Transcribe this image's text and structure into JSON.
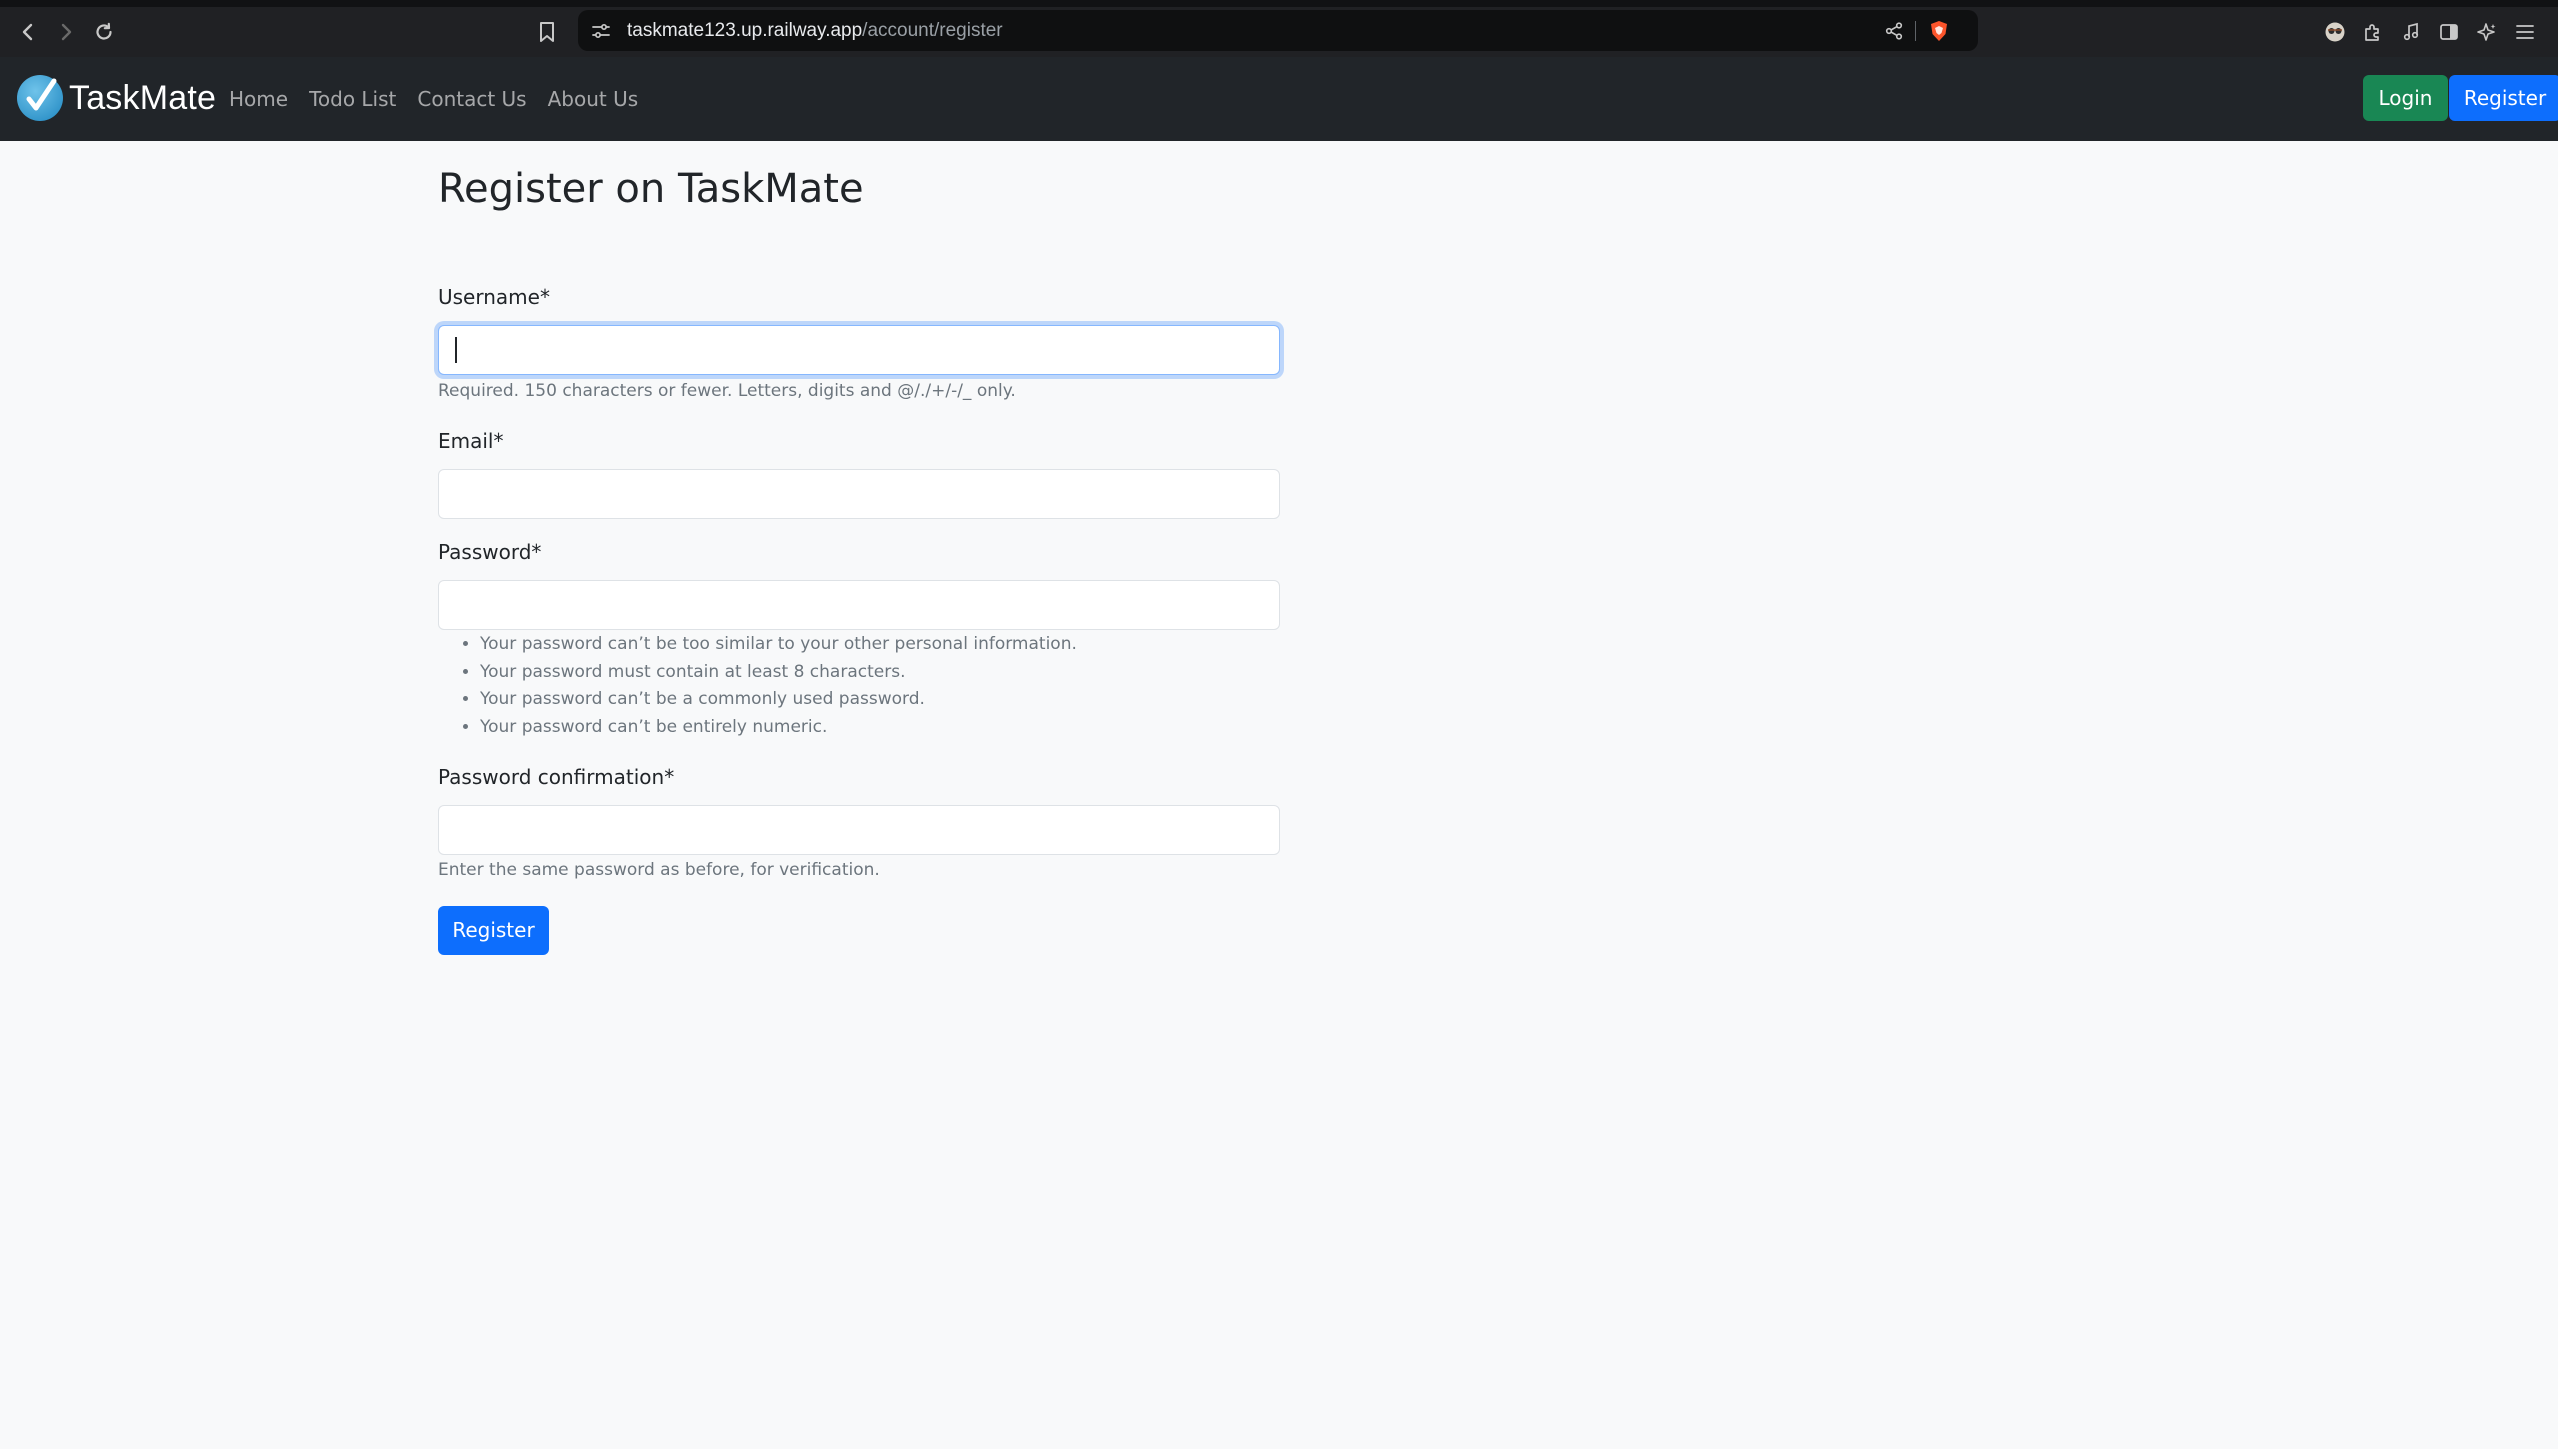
{
  "browser": {
    "url_host": "taskmate123.up.railway.app",
    "url_path": "/account/register",
    "icons": [
      "back-icon",
      "forward-icon",
      "reload-icon",
      "bookmark-icon",
      "site-settings-icon",
      "share-icon",
      "brave-shield-icon",
      "extension-avatar-icon",
      "extensions-icon",
      "media-icon",
      "sidebar-icon",
      "leo-ai-icon",
      "menu-icon"
    ]
  },
  "navbar": {
    "brand": "TaskMate",
    "links": [
      "Home",
      "Todo List",
      "Contact Us",
      "About Us"
    ],
    "login_label": "Login",
    "register_label": "Register",
    "colors": {
      "background": "#212529",
      "login": "#198754",
      "register": "#0d6efd"
    }
  },
  "form": {
    "title": "Register on TaskMate",
    "username": {
      "label": "Username*",
      "value": "",
      "help": "Required. 150 characters or fewer. Letters, digits and @/./+/-/_ only."
    },
    "email": {
      "label": "Email*",
      "value": ""
    },
    "password": {
      "label": "Password*",
      "value": "",
      "rules": [
        "Your password can’t be too similar to your other personal information.",
        "Your password must contain at least 8 characters.",
        "Your password can’t be a commonly used password.",
        "Your password can’t be entirely numeric."
      ]
    },
    "password_confirmation": {
      "label": "Password confirmation*",
      "value": "",
      "help": "Enter the same password as before, for verification."
    },
    "submit_label": "Register"
  }
}
